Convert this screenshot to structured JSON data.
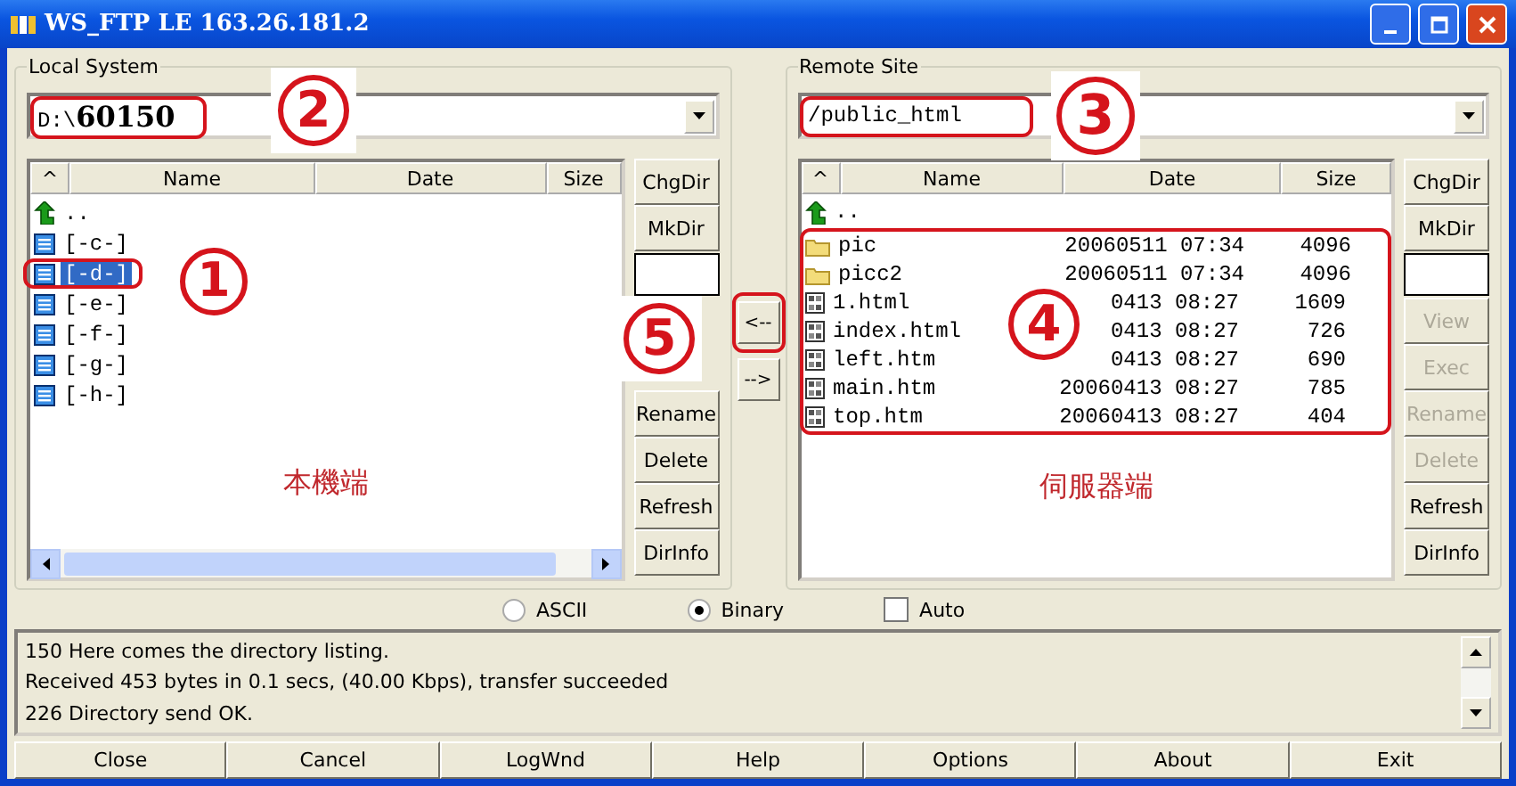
{
  "window": {
    "title": "WS_FTP LE 163.26.181.2"
  },
  "local": {
    "legend": "Local System",
    "path": "D:\\**60150**",
    "columns": [
      "^",
      "Name",
      "Date",
      "Size"
    ],
    "items": [
      {
        "name": "..",
        "kind": "up",
        "selected": false
      },
      {
        "name": "[-c-]",
        "kind": "drive",
        "selected": false
      },
      {
        "name": "[-d-]",
        "kind": "drive",
        "selected": true
      },
      {
        "name": "[-e-]",
        "kind": "drive",
        "selected": false
      },
      {
        "name": "[-f-]",
        "kind": "drive",
        "selected": false
      },
      {
        "name": "[-g-]",
        "kind": "drive",
        "selected": false
      },
      {
        "name": "[-h-]",
        "kind": "drive",
        "selected": false
      }
    ],
    "caption": "本機端",
    "buttons_top": [
      {
        "label": "ChgDir",
        "disabled": false
      },
      {
        "label": "MkDir",
        "disabled": false
      }
    ],
    "buttons_bottom": [
      {
        "label": "Rename",
        "disabled": false
      },
      {
        "label": "Delete",
        "disabled": false
      },
      {
        "label": "Refresh",
        "disabled": false
      },
      {
        "label": "DirInfo",
        "disabled": false
      }
    ]
  },
  "transfer": [
    "<--",
    "-->"
  ],
  "remote": {
    "legend": "Remote Site",
    "path": "/public_html",
    "columns": [
      "^",
      "Name",
      "Date",
      "Size"
    ],
    "items": [
      {
        "name": "..",
        "kind": "up"
      },
      {
        "name": "pic",
        "kind": "folder",
        "date": "20060511 07:34",
        "size": "4096"
      },
      {
        "name": "picc2",
        "kind": "folder",
        "date": "20060511 07:34",
        "size": "4096"
      },
      {
        "name": "1.html",
        "kind": "file",
        "date": "0413 08:27",
        "size": "1609"
      },
      {
        "name": "index.html",
        "kind": "file",
        "date": "0413 08:27",
        "size": "726"
      },
      {
        "name": "left.htm",
        "kind": "file",
        "date": "0413 08:27",
        "size": "690"
      },
      {
        "name": "main.htm",
        "kind": "file",
        "date": "20060413 08:27",
        "size": "785"
      },
      {
        "name": "top.htm",
        "kind": "file",
        "date": "20060413 08:27",
        "size": "404"
      }
    ],
    "caption": "伺服器端",
    "buttons_top": [
      {
        "label": "ChgDir",
        "disabled": false
      },
      {
        "label": "MkDir",
        "disabled": false
      }
    ],
    "buttons_bottom": [
      {
        "label": "View",
        "disabled": true
      },
      {
        "label": "Exec",
        "disabled": true
      },
      {
        "label": "Rename",
        "disabled": true
      },
      {
        "label": "Delete",
        "disabled": true
      },
      {
        "label": "Refresh",
        "disabled": false
      },
      {
        "label": "DirInfo",
        "disabled": false
      }
    ]
  },
  "modes": [
    {
      "label": "ASCII",
      "selected": false
    },
    {
      "label": "Binary",
      "selected": true
    }
  ],
  "auto": {
    "label": "Auto",
    "checked": false
  },
  "log": [
    "150 Here comes the directory listing.",
    "Received 453 bytes in 0.1 secs, (40.00 Kbps), transfer succeeded",
    "226 Directory send OK."
  ],
  "bottom_buttons": [
    "Close",
    "Cancel",
    "LogWnd",
    "Help",
    "Options",
    "About",
    "Exit"
  ],
  "callouts": [
    {
      "label": "2"
    },
    {
      "label": "1"
    },
    {
      "label": "3"
    },
    {
      "label": "4"
    },
    {
      "label": "5"
    }
  ]
}
